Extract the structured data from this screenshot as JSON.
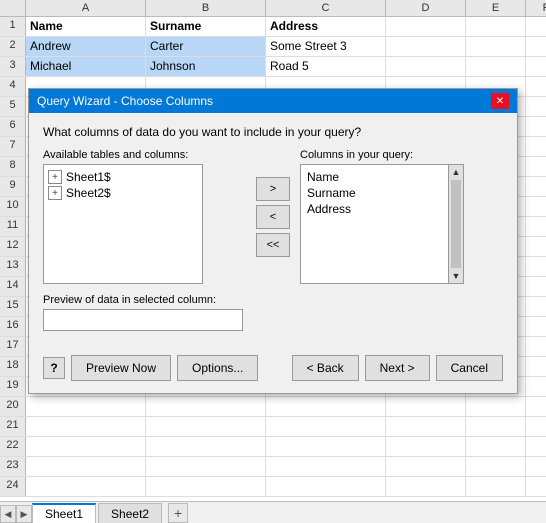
{
  "spreadsheet": {
    "col_headers": [
      "",
      "A",
      "B",
      "C",
      "D",
      "E",
      "F"
    ],
    "rows": [
      {
        "num": "1",
        "a": "Name",
        "b": "Surname",
        "c": "Address",
        "d": "",
        "e": "",
        "f": "",
        "bold": true
      },
      {
        "num": "2",
        "a": "Andrew",
        "b": "Carter",
        "c": "Some Street 3",
        "d": "",
        "e": "",
        "f": "",
        "highlighted": true
      },
      {
        "num": "3",
        "a": "Michael",
        "b": "Johnson",
        "c": "Road 5",
        "d": "",
        "e": "",
        "f": "",
        "highlighted": true
      },
      {
        "num": "4",
        "a": "",
        "b": "",
        "c": "",
        "d": "",
        "e": "",
        "f": ""
      },
      {
        "num": "5",
        "a": "",
        "b": "",
        "c": "",
        "d": "",
        "e": "",
        "f": ""
      },
      {
        "num": "6",
        "a": "",
        "b": "",
        "c": "",
        "d": "",
        "e": "",
        "f": ""
      },
      {
        "num": "7",
        "a": "",
        "b": "",
        "c": "",
        "d": "",
        "e": "",
        "f": ""
      },
      {
        "num": "8",
        "a": "",
        "b": "",
        "c": "",
        "d": "",
        "e": "",
        "f": ""
      },
      {
        "num": "9",
        "a": "",
        "b": "",
        "c": "",
        "d": "",
        "e": "",
        "f": ""
      },
      {
        "num": "10",
        "a": "",
        "b": "",
        "c": "",
        "d": "",
        "e": "",
        "f": ""
      },
      {
        "num": "11",
        "a": "",
        "b": "",
        "c": "",
        "d": "",
        "e": "",
        "f": ""
      },
      {
        "num": "12",
        "a": "",
        "b": "",
        "c": "",
        "d": "",
        "e": "",
        "f": ""
      },
      {
        "num": "13",
        "a": "",
        "b": "",
        "c": "",
        "d": "",
        "e": "",
        "f": ""
      },
      {
        "num": "14",
        "a": "",
        "b": "",
        "c": "",
        "d": "",
        "e": "",
        "f": ""
      },
      {
        "num": "15",
        "a": "",
        "b": "",
        "c": "",
        "d": "",
        "e": "",
        "f": ""
      },
      {
        "num": "16",
        "a": "",
        "b": "",
        "c": "",
        "d": "",
        "e": "",
        "f": ""
      },
      {
        "num": "17",
        "a": "",
        "b": "",
        "c": "",
        "d": "",
        "e": "",
        "f": ""
      },
      {
        "num": "18",
        "a": "",
        "b": "",
        "c": "",
        "d": "",
        "e": "",
        "f": ""
      },
      {
        "num": "19",
        "a": "",
        "b": "",
        "c": "",
        "d": "",
        "e": "",
        "f": ""
      },
      {
        "num": "20",
        "a": "",
        "b": "",
        "c": "",
        "d": "",
        "e": "",
        "f": ""
      },
      {
        "num": "21",
        "a": "",
        "b": "",
        "c": "",
        "d": "",
        "e": "",
        "f": ""
      },
      {
        "num": "22",
        "a": "",
        "b": "",
        "c": "",
        "d": "",
        "e": "",
        "f": ""
      },
      {
        "num": "23",
        "a": "",
        "b": "",
        "c": "",
        "d": "",
        "e": "",
        "f": ""
      },
      {
        "num": "24",
        "a": "",
        "b": "",
        "c": "",
        "d": "",
        "e": "",
        "f": ""
      }
    ]
  },
  "dialog": {
    "title": "Query Wizard - Choose Columns",
    "question": "What columns of data do you want to include in your query?",
    "avail_label": "Available tables and columns:",
    "query_label": "Columns in your query:",
    "tables": [
      {
        "name": "Sheet1$"
      },
      {
        "name": "Sheet2$"
      }
    ],
    "query_columns": [
      "Name",
      "Surname",
      "Address"
    ],
    "preview_label": "Preview of data in selected column:",
    "preview_value": "",
    "arrows": {
      "right": ">",
      "left": "<",
      "left_all": "<<"
    },
    "buttons": {
      "help": "?",
      "preview_now": "Preview Now",
      "options": "Options...",
      "back": "< Back",
      "next": "Next >",
      "cancel": "Cancel"
    }
  },
  "sheets": {
    "tabs": [
      "Sheet1",
      "Sheet2"
    ],
    "active": "Sheet1"
  }
}
